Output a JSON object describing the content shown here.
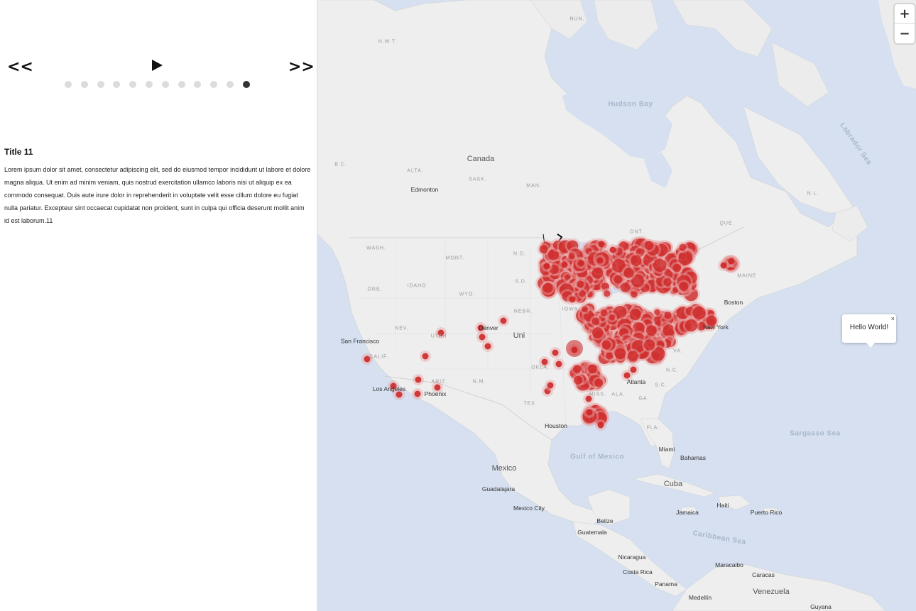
{
  "controls": {
    "prev_label": "<<",
    "next_label": ">>",
    "play_icon": "play-icon",
    "slide_count": 12,
    "active_slide": 12
  },
  "story": {
    "title": "Title 11",
    "body": "Lorem ipsum dolor sit amet, consectetur adipiscing elit, sed do eiusmod tempor incididunt ut labore et dolore magna aliqua. Ut enim ad minim veniam, quis nostrud exercitation ullamco laboris nisi ut aliquip ex ea commodo consequat. Duis aute irure dolor in reprehenderit in voluptate velit esse cillum dolore eu fugiat nulla pariatur. Excepteur sint occaecat cupidatat non proident, sunt in culpa qui officia deserunt mollit anim id est laborum.11"
  },
  "map": {
    "zoom_in_label": "+",
    "zoom_out_label": "−",
    "popup_text": "Hello World!",
    "popup_close": "×",
    "colors": {
      "water": "#d6e0f0",
      "land": "#eeeeee",
      "marker": "#cc1f1f",
      "marker_halo": "#e8a3a3"
    },
    "labels": {
      "nwt": "N.W.T.",
      "nun": "NUN.",
      "hudson_bay": "Hudson Bay",
      "labrador_sea": "Labrador Sea",
      "canada": "Canada",
      "bc": "B.C.",
      "alta": "ALTA.",
      "sask": "SASK.",
      "man": "MAN.",
      "edmonton": "Edmonton",
      "ont": "ONT.",
      "que": "QUE.",
      "nl": "N.L.",
      "wash": "WASH.",
      "mont": "MONT.",
      "nd": "N.D.",
      "ore": "ORE.",
      "idaho": "IDAHO",
      "wyo": "WYO.",
      "sd": "S.D.",
      "maine": "MAINE",
      "boston": "Boston",
      "nebr": "NEBR.",
      "iowa": "IOWA",
      "nev": "NEV.",
      "utah": "UTAH",
      "denver": "Denver",
      "united": "Uni",
      "san_francisco": "San Francisco",
      "calif": "CALIF.",
      "new_york": "New York",
      "va": "VA.",
      "okla": "OKLA.",
      "nc": "N.C.",
      "ariz": "ARIZ.",
      "nm": "N.M.",
      "atlanta": "Atlanta",
      "sc": "S.C.",
      "los_angeles": "Los Angeles",
      "phoenix": "Phoenix",
      "miss": "MISS.",
      "ala": "ALA.",
      "ga": "GA.",
      "tex": "TEX.",
      "houston": "Houston",
      "fla": "FLA.",
      "sargasso": "Sargasso Sea",
      "gulf": "Gulf of Mexico",
      "miami": "Miami",
      "bahamas": "Bahamas",
      "mexico": "Mexico",
      "guadalajara": "Guadalajara",
      "cuba": "Cuba",
      "mexico_city": "Mexico City",
      "haiti": "Haiti",
      "puerto_rico": "Puerto Rico",
      "belize": "Belize",
      "jamaica": "Jamaica",
      "guatemala": "Guatemala",
      "caribbean": "Caribbean Sea",
      "nicaragua": "Nicaragua",
      "maracaibo": "Maracaibo",
      "costa_rica": "Costa Rica",
      "caracas": "Caracas",
      "panama": "Panama",
      "medellin": "Medellín",
      "venezuela": "Venezuela",
      "guyana": "Guyana"
    }
  }
}
